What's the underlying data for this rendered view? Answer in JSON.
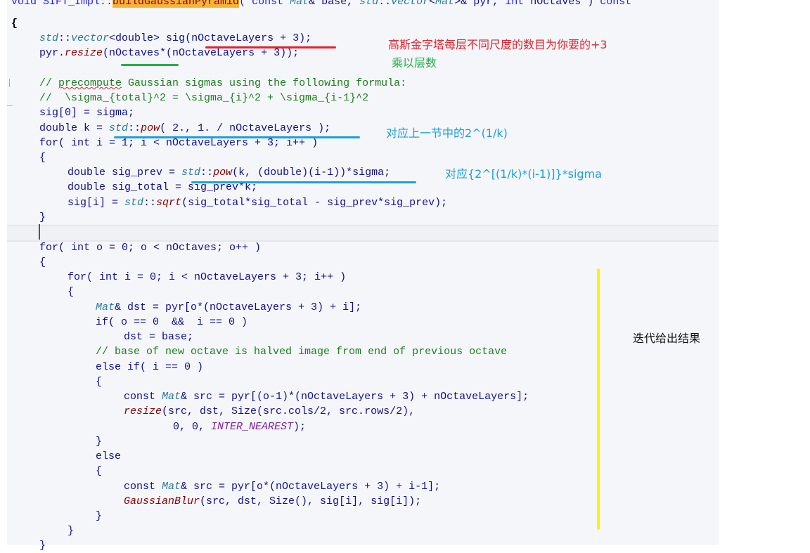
{
  "code": {
    "signature": {
      "prefix": "void SIFT_Impl::",
      "function_name": "buildGaussianPyramid",
      "suffix_1": "( const ",
      "type_mat": "Mat",
      "suffix_2": "& base, ",
      "std_ns": "std",
      "sep": "::",
      "vector": "vector",
      "lt": "<",
      "type_mat_2": "Mat",
      "suffix_3": ">& pyr, ",
      "int_kw": "int",
      "suffix_4": " nOctaves ) ",
      "const_kw": "const"
    },
    "lines": {
      "open_brace": "{",
      "l1_std": "std",
      "l1_sep": "::",
      "l1_vector": "vector",
      "l1_rest": "<double> sig(nOctaveLayers + 3);",
      "l2_a": "pyr.",
      "l2_fn": "resize",
      "l2_b": "(nOctaves*(nOctaveLayers + 3));",
      "c1_a": "// ",
      "c1_word": "precompute",
      "c1_b": " Gaussian sigmas using the following formula:",
      "c2": "//  \\sigma_{total}^2 = \\sigma_{i}^2 + \\sigma_{i-1}^2",
      "l3": "sig[0] = sigma;",
      "l4_a": "double k = ",
      "l4_std": "std",
      "l4_sep": "::",
      "l4_fn": "pow",
      "l4_b": "( 2., 1. / nOctaveLayers );",
      "l5": "for( int i = 1; i < nOctaveLayers + 3; i++ )",
      "l6": "{",
      "l7_a": "double sig_prev = ",
      "l7_std": "std",
      "l7_sep": "::",
      "l7_fn": "pow",
      "l7_b": "(k, (double)(i-1))*sigma;",
      "l8": "double sig_total = sig_prev*k;",
      "l9_a": "sig[i] = ",
      "l9_std": "std",
      "l9_sep": "::",
      "l9_fn": "sqrt",
      "l9_b": "(sig_total*sig_total - sig_prev*sig_prev);",
      "l10": "}",
      "l11": "for( int o = 0; o < nOctaves; o++ )",
      "l12": "{",
      "l13": "for( int i = 0; i < nOctaveLayers + 3; i++ )",
      "l14": "{",
      "l15_ty": "Mat",
      "l15_b": "& dst = pyr[o*(nOctaveLayers + 3) + i];",
      "l16": "if( o == 0  &&  i == 0 )",
      "l17": "dst = base;",
      "l18": "// base of new octave is halved image from end of previous octave",
      "l19": "else if( i == 0 )",
      "l20": "{",
      "l21_a": "const ",
      "l21_ty": "Mat",
      "l21_b": "& src = pyr[(o-1)*(nOctaveLayers + 3) + nOctaveLayers];",
      "l22_fn": "resize",
      "l22_b": "(src, dst, Size(src.cols/2, src.rows/2),",
      "l23_a": "0, 0, ",
      "l23_mac": "INTER_NEAREST",
      "l23_b": ");",
      "l24": "}",
      "l25": "else",
      "l26": "{",
      "l27_a": "const ",
      "l27_ty": "Mat",
      "l27_b": "& src = pyr[o*(nOctaveLayers + 3) + i-1];",
      "l28_fn": "GaussianBlur",
      "l28_b": "(src, dst, Size(), sig[i], sig[i]);",
      "l29": "}",
      "l30": "}",
      "l31": "}"
    }
  },
  "annotations": {
    "note_red": "高斯金字塔每层不同尺度的数目为你要的+3",
    "note_green": "乘以层数",
    "note_blue_1": "对应上一节中的2^(1/k)",
    "note_blue_2": "对应{2^[(1/k)*(i-1)]}*sigma",
    "note_black": "迭代给出结果"
  },
  "colors": {
    "red": "#e8202a",
    "green": "#22b04a",
    "blue": "#1aa0dc",
    "yellow": "#fff200",
    "highlight": "#f6b33a"
  }
}
